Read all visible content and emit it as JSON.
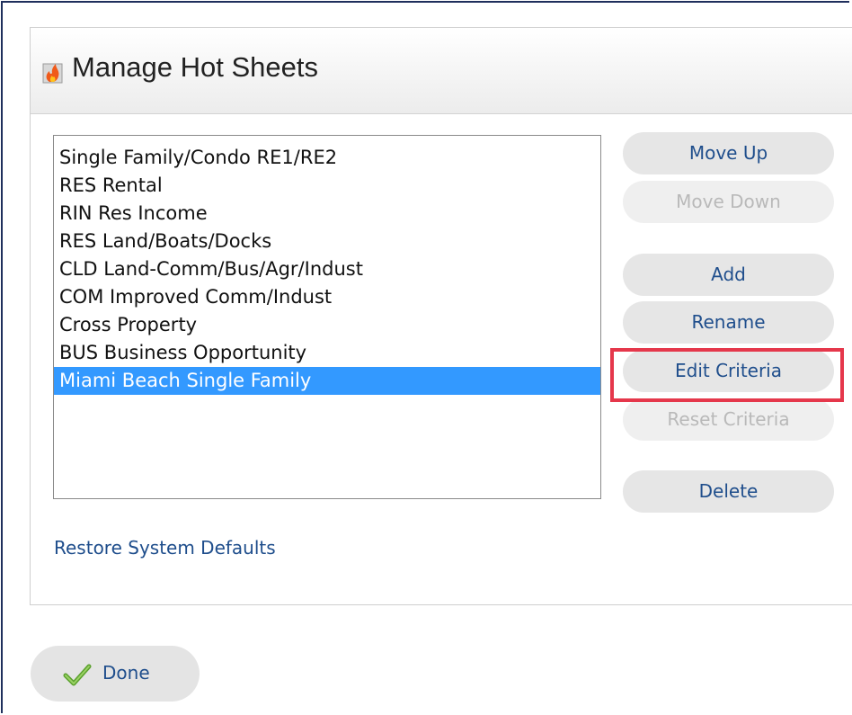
{
  "dialog": {
    "title": "Manage Hot Sheets",
    "icon": "fire-icon"
  },
  "hot_sheets": {
    "items": [
      "Single Family/Condo RE1/RE2",
      "RES Rental",
      "RIN Res Income",
      "RES Land/Boats/Docks",
      "CLD Land-Comm/Bus/Agr/Indust",
      "COM Improved Comm/Indust",
      "Cross Property",
      "BUS Business Opportunity",
      "Miami Beach Single Family"
    ],
    "selected": "Miami Beach Single Family"
  },
  "buttons": {
    "move_up": "Move Up",
    "move_down": "Move Down",
    "add": "Add",
    "rename": "Rename",
    "edit_criteria": "Edit Criteria",
    "reset_criteria": "Reset Criteria",
    "delete": "Delete"
  },
  "links": {
    "restore_defaults": "Restore System Defaults"
  },
  "footer": {
    "done_label": "Done",
    "done_icon": "checkmark-icon"
  },
  "colors": {
    "selection": "#3399ff",
    "link": "#1f4e8c",
    "highlight": "#e5374b",
    "frame": "#1f2f5c"
  }
}
